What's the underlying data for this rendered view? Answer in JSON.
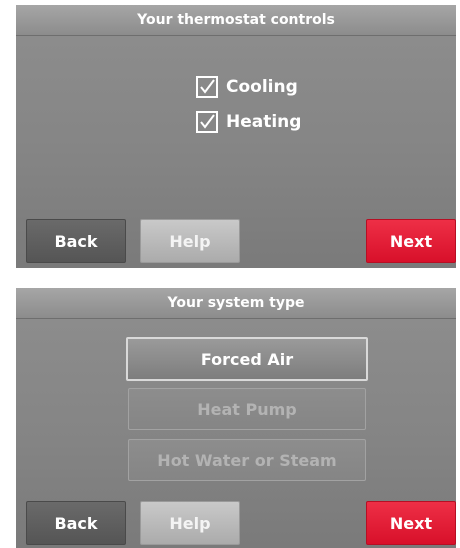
{
  "screen1": {
    "title": "Your thermostat controls",
    "options": [
      {
        "label": "Cooling",
        "checked": true
      },
      {
        "label": "Heating",
        "checked": true
      }
    ],
    "buttons": {
      "back": "Back",
      "help": "Help",
      "next": "Next"
    }
  },
  "screen2": {
    "title": "Your system type",
    "options": [
      {
        "label": "Forced Air",
        "selected": true
      },
      {
        "label": "Heat Pump",
        "selected": false
      },
      {
        "label": "Hot Water or Steam",
        "selected": false
      }
    ],
    "buttons": {
      "back": "Back",
      "help": "Help",
      "next": "Next"
    }
  },
  "colors": {
    "screen_bg": "#8a8a8a",
    "next_button": "#e01d35",
    "back_button": "#5f5f5f",
    "help_button": "#bdbdbd",
    "text": "#ffffff"
  },
  "icons": [
    "checkmark-icon"
  ]
}
